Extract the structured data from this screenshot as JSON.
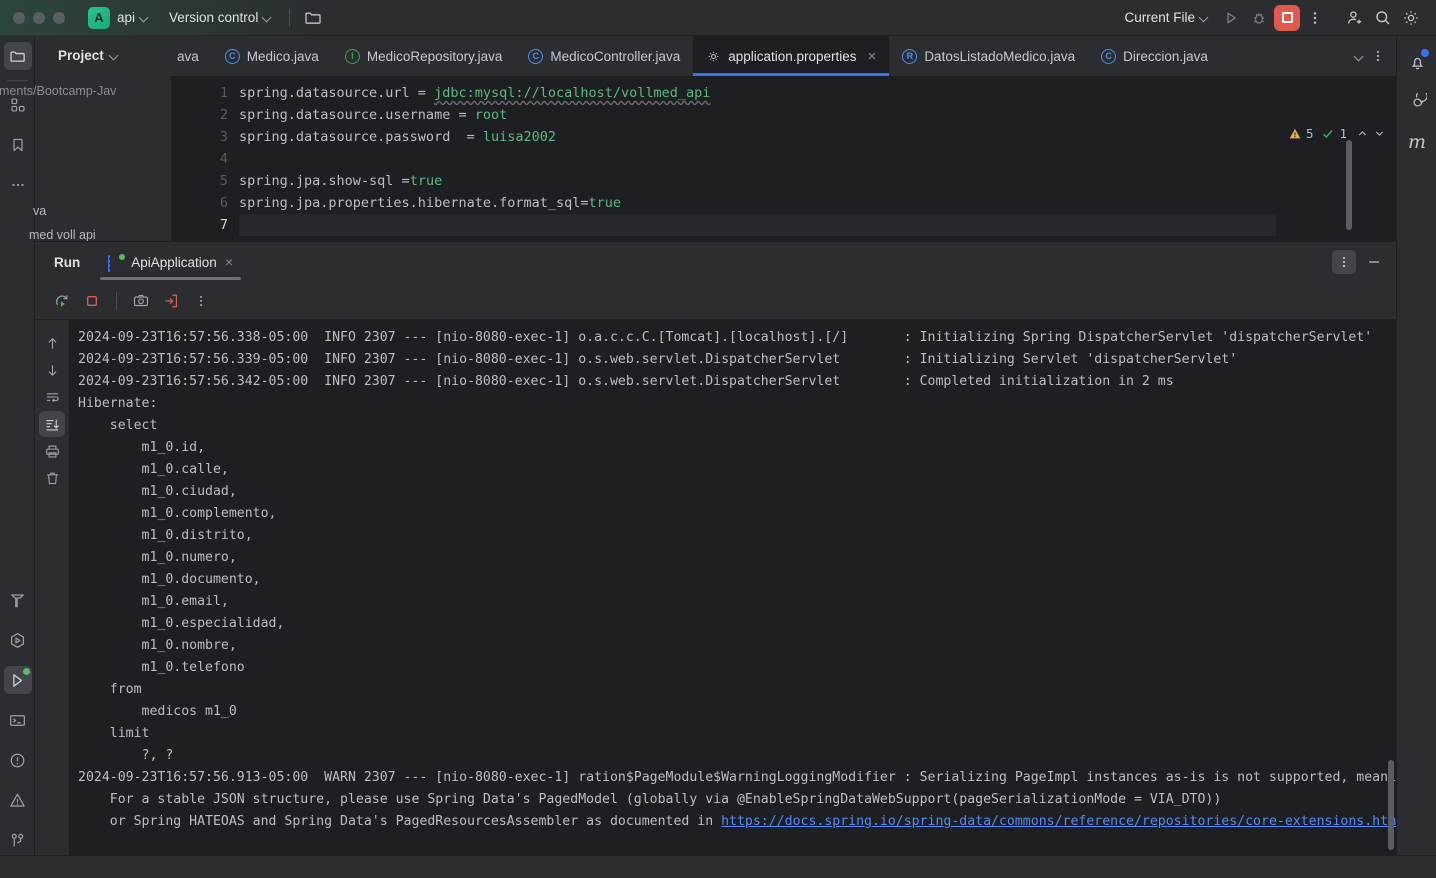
{
  "titlebar": {
    "project_initial": "A",
    "project_name": "api",
    "vcs_label": "Version control",
    "folder_icon": "folder-icon",
    "run_config": "Current File",
    "run_icon": "run-icon",
    "debug_icon": "debug-icon",
    "stop_icon": "stop-icon",
    "more_icon": "more-vertical-icon",
    "account_icon": "add-user-icon",
    "search_icon": "search-icon",
    "settings_icon": "gear-icon"
  },
  "left_rail": {
    "items": [
      {
        "name": "project-icon",
        "selected": true
      },
      {
        "name": "structure-icon",
        "selected": false
      },
      {
        "name": "bookmarks-icon",
        "selected": false
      },
      {
        "name": "more-tool-windows-icon",
        "selected": false
      }
    ],
    "bottom_items": [
      {
        "name": "build-icon",
        "selected": false
      },
      {
        "name": "services-icon",
        "selected": false
      },
      {
        "name": "run-icon",
        "selected": true,
        "badge": "green"
      },
      {
        "name": "terminal-icon",
        "selected": false
      },
      {
        "name": "problems-icon",
        "selected": false
      },
      {
        "name": "warnings-icon",
        "selected": false
      },
      {
        "name": "git-icon",
        "selected": false
      }
    ]
  },
  "right_rail": {
    "items": [
      {
        "name": "notifications-icon",
        "badge": "blue"
      },
      {
        "name": "ai-assistant-icon",
        "badge": ""
      },
      {
        "name": "maven-icon",
        "label": "m",
        "badge": ""
      }
    ]
  },
  "project_panel": {
    "title": "Project",
    "path_fragment": "ments/Bootcamp-Jav",
    "file_fragment_1": "va",
    "file_fragment_2": "med voll api"
  },
  "editor": {
    "tabs": [
      {
        "label": "ava",
        "icon": "",
        "active": false,
        "partial": true
      },
      {
        "label": "Medico.java",
        "icon": "class-icon",
        "active": false
      },
      {
        "label": "MedicoRepository.java",
        "icon": "interface-icon",
        "active": false
      },
      {
        "label": "MedicoController.java",
        "icon": "class-icon",
        "active": false
      },
      {
        "label": "application.properties",
        "icon": "properties-icon",
        "active": true
      },
      {
        "label": "DatosListadoMedico.java",
        "icon": "record-icon",
        "active": false
      },
      {
        "label": "Direccion.java",
        "icon": "class-icon",
        "active": false
      }
    ],
    "tab_close_label": "×",
    "tabbar_chevron_icon": "chevron-down-icon",
    "tabbar_more_icon": "more-vertical-icon",
    "line_numbers": [
      "1",
      "2",
      "3",
      "4",
      "5",
      "6",
      "7"
    ],
    "current_line": "7",
    "code": [
      {
        "num": "1",
        "key": "spring.datasource.url = ",
        "val": "jdbc:mysql://localhost/vollmed_api"
      },
      {
        "num": "2",
        "key": "spring.datasource.username = ",
        "val": "root"
      },
      {
        "num": "3",
        "key": "spring.datasource.password  = ",
        "val": "luisa2002"
      },
      {
        "num": "4",
        "key": "",
        "val": ""
      },
      {
        "num": "5",
        "key": "spring.jpa.show-sql =",
        "val": "true"
      },
      {
        "num": "6",
        "key": "spring.jpa.properties.hibernate.format_sql=",
        "val": "true"
      },
      {
        "num": "7",
        "key": "",
        "val": ""
      }
    ],
    "inspections": {
      "warning_icon": "warning-triangle-icon",
      "warning_count": "5",
      "ok_icon": "inspection-ok-icon",
      "ok_count": "1",
      "prev_icon": "chevron-up-icon",
      "next_icon": "chevron-down-icon"
    }
  },
  "run_window": {
    "title": "Run",
    "tab_label": "ApiApplication",
    "tab_icon": "spring-run-config-icon",
    "tab_close": "×",
    "options_icon": "more-vertical-icon",
    "minimize_icon": "minimize-icon",
    "toolbar": [
      {
        "name": "rerun-icon"
      },
      {
        "name": "stop-icon"
      },
      {
        "name": "screenshot-icon"
      },
      {
        "name": "export-icon"
      },
      {
        "name": "more-vertical-icon"
      }
    ],
    "console_gutter": [
      {
        "name": "scroll-up-icon",
        "selected": false
      },
      {
        "name": "scroll-down-icon",
        "selected": false
      },
      {
        "name": "soft-wrap-icon",
        "selected": false
      },
      {
        "name": "scroll-to-end-icon",
        "selected": true
      },
      {
        "name": "print-icon",
        "selected": false
      },
      {
        "name": "clear-all-icon",
        "selected": false
      }
    ],
    "console_lines": [
      "2024-09-23T16:57:56.338-05:00  INFO 2307 --- [nio-8080-exec-1] o.a.c.c.C.[Tomcat].[localhost].[/]       : Initializing Spring DispatcherServlet 'dispatcherServlet'",
      "2024-09-23T16:57:56.339-05:00  INFO 2307 --- [nio-8080-exec-1] o.s.web.servlet.DispatcherServlet        : Initializing Servlet 'dispatcherServlet'",
      "2024-09-23T16:57:56.342-05:00  INFO 2307 --- [nio-8080-exec-1] o.s.web.servlet.DispatcherServlet        : Completed initialization in 2 ms",
      "Hibernate: ",
      "    select",
      "        m1_0.id,",
      "        m1_0.calle,",
      "        m1_0.ciudad,",
      "        m1_0.complemento,",
      "        m1_0.distrito,",
      "        m1_0.numero,",
      "        m1_0.documento,",
      "        m1_0.email,",
      "        m1_0.especialidad,",
      "        m1_0.nombre,",
      "        m1_0.telefono",
      "    from",
      "        medicos m1_0",
      "    limit",
      "        ?, ?"
    ],
    "warn_line": "2024-09-23T16:57:56.913-05:00  WARN 2307 --- [nio-8080-exec-1] ration$PageModule$WarningLoggingModifier : Serializing PageImpl instances as-is is not supported, meaning",
    "warn_line_2": "    For a stable JSON structure, please use Spring Data's PagedModel (globally via @EnableSpringDataWebSupport(pageSerializationMode = VIA_DTO))",
    "warn_line_3_pre": "    or Spring HATEOAS and Spring Data's PagedResourcesAssembler as documented in ",
    "warn_line_3_link": "https://docs.spring.io/spring-data/commons/reference/repositories/core-extensions.html#"
  },
  "statusbar": {
    "left": "",
    "right": ""
  },
  "colors": {
    "accent_blue": "#3574f0",
    "stop_red": "#e1584e",
    "green": "#5fb865",
    "bg_dark": "#1e1f22",
    "bg_panel": "#2b2d30"
  }
}
